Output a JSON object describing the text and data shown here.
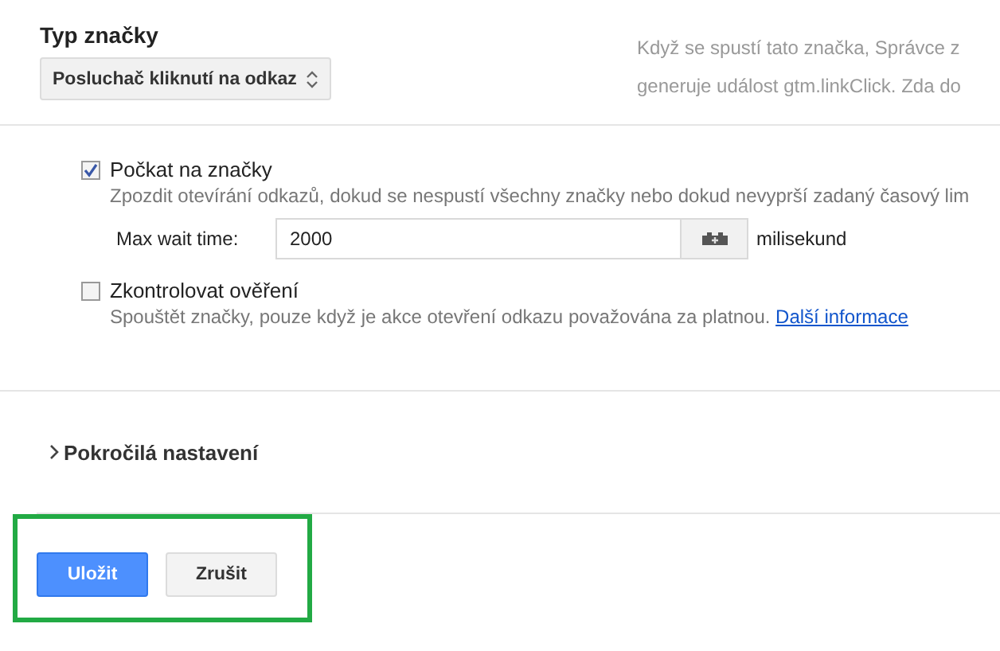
{
  "tag_type": {
    "heading": "Typ značky",
    "select": {
      "value": "Posluchač kliknutí na odkaz"
    }
  },
  "help_text": [
    "Když se spustí tato značka, Správce z",
    "generuje událost gtm.linkClick. Zda do"
  ],
  "options": [
    {
      "label": "Počkat na značky",
      "checked": true,
      "description": "Zpozdit otevírání odkazů, dokud se nespustí všechny značky nebo dokud nevyprší zadaný časový lim",
      "max_wait": {
        "label": "Max wait time:",
        "value": "2000",
        "unit": "milisekund"
      }
    },
    {
      "label": "Zkontrolovat ověření",
      "checked": false,
      "description": "Spouštět značky, pouze když je akce otevření odkazu považována za platnou.",
      "link": "Další informace"
    }
  ],
  "advanced": {
    "label": "Pokročilá nastavení",
    "expanded": false
  },
  "buttons": [
    {
      "label": "Uložit",
      "kind": "primary"
    },
    {
      "label": "Zrušit",
      "kind": "secondary"
    }
  ]
}
